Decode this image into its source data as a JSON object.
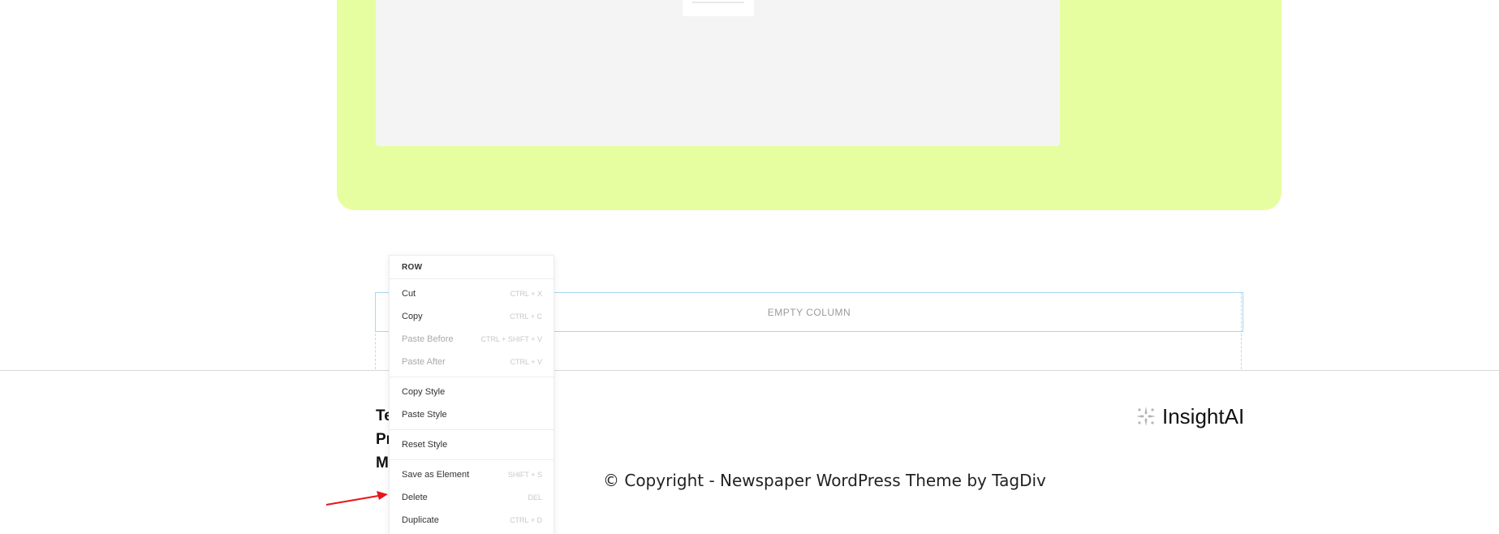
{
  "placeholder": {
    "empty_column_label": "EMPTY COLUMN"
  },
  "footer": {
    "links": [
      "Te",
      "Pr",
      "M"
    ],
    "brand_name": "InsightAI",
    "copyright": "© Copyright - Newspaper WordPress Theme by TagDiv"
  },
  "context_menu": {
    "header": "ROW",
    "groups": [
      [
        {
          "label": "Cut",
          "shortcut": "CTRL + X",
          "enabled": true
        },
        {
          "label": "Copy",
          "shortcut": "CTRL + C",
          "enabled": true
        },
        {
          "label": "Paste Before",
          "shortcut": "CTRL + SHIFT + V",
          "enabled": false
        },
        {
          "label": "Paste After",
          "shortcut": "CTRL + V",
          "enabled": false
        }
      ],
      [
        {
          "label": "Copy Style",
          "shortcut": "",
          "enabled": true
        },
        {
          "label": "Paste Style",
          "shortcut": "",
          "enabled": true
        }
      ],
      [
        {
          "label": "Reset Style",
          "shortcut": "",
          "enabled": true
        }
      ],
      [
        {
          "label": "Save as Element",
          "shortcut": "SHIFT + S",
          "enabled": true
        },
        {
          "label": "Delete",
          "shortcut": "DEL",
          "enabled": true
        },
        {
          "label": "Duplicate",
          "shortcut": "CTRL + D",
          "enabled": true
        }
      ]
    ]
  },
  "colors": {
    "accent_block": "#e6fea0",
    "annotation_arrow": "#e8141c",
    "column_outline": "#a8d8ee"
  },
  "icons": {
    "brand_logo": "sparkle-cluster-icon",
    "annotation": "red-arrow-icon"
  }
}
